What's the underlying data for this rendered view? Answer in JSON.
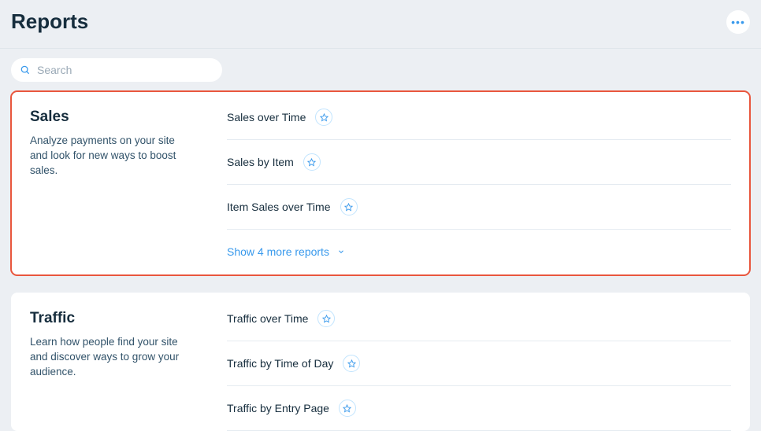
{
  "header": {
    "title": "Reports"
  },
  "search": {
    "placeholder": "Search"
  },
  "sections": [
    {
      "title": "Sales",
      "desc": "Analyze payments on your site and look for new ways to boost sales.",
      "highlighted": true,
      "reports": [
        {
          "label": "Sales over Time"
        },
        {
          "label": "Sales by Item"
        },
        {
          "label": "Item Sales over Time"
        }
      ],
      "show_more": "Show 4 more reports"
    },
    {
      "title": "Traffic",
      "desc": "Learn how people find your site and discover ways to grow your audience.",
      "highlighted": false,
      "reports": [
        {
          "label": "Traffic over Time"
        },
        {
          "label": "Traffic by Time of Day"
        },
        {
          "label": "Traffic by Entry Page"
        }
      ],
      "show_more": ""
    }
  ]
}
